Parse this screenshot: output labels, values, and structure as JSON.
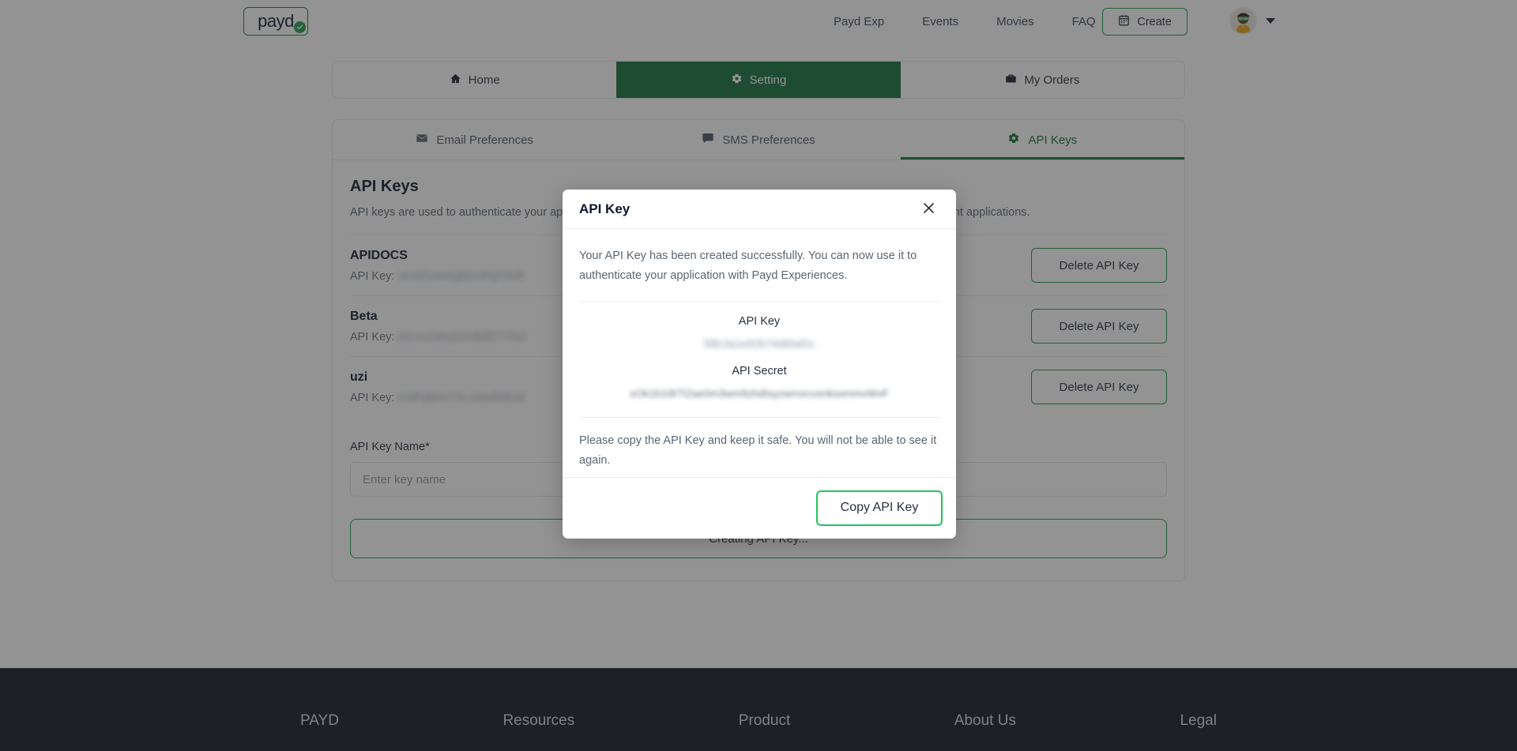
{
  "header": {
    "logo_text": "payd",
    "logo_icon": "check-circle-icon",
    "nav": [
      {
        "label": "Payd Exp"
      },
      {
        "label": "Events"
      },
      {
        "label": "Movies"
      },
      {
        "label": "FAQ"
      }
    ],
    "create_button": {
      "label": "Create",
      "icon": "calendar-icon"
    },
    "avatar": {
      "icon": "user-avatar"
    },
    "caret_icon": "chevron-down-icon"
  },
  "main_tabs": [
    {
      "label": "Home",
      "icon": "home-icon",
      "active": false
    },
    {
      "label": "Setting",
      "icon": "gear-icon",
      "active": true
    },
    {
      "label": "My Orders",
      "icon": "briefcase-icon",
      "active": false
    }
  ],
  "sub_tabs": [
    {
      "label": "Email Preferences",
      "icon": "envelope-icon",
      "active": false
    },
    {
      "label": "SMS Preferences",
      "icon": "chat-bubble-icon",
      "active": false
    },
    {
      "label": "API Keys",
      "icon": "gear-icon",
      "active": true
    }
  ],
  "panel": {
    "title": "API Keys",
    "description": "API keys are used to authenticate your applications with Payd Experiences. You can create multiple API keys for different applications.",
    "key_label_prefix": "API Key:",
    "keys": [
      {
        "name": "APIDOCS",
        "value": "xK4d1ow0q8ZmPqT3vR",
        "delete_label": "Delete API Key"
      },
      {
        "name": "Beta",
        "value": "j9Lmv2Wq5XnBdE7rTaZ",
        "delete_label": "Delete API Key"
      },
      {
        "name": "uzi",
        "value": "m3Pq8XvT2LcNwR5kJd",
        "delete_label": "Delete API Key"
      }
    ],
    "form": {
      "label": "API Key Name*",
      "placeholder": "Enter key name",
      "value": "",
      "submit_label": "Creating API Key..."
    }
  },
  "modal": {
    "title": "API Key",
    "close_icon": "close-icon",
    "intro": "Your API Key has been created successfully. You can now use it to authenticate your application with Payd Experiences.",
    "api_key_label": "API Key",
    "api_key_value": "5f8c3a1e92b74d60af2c",
    "api_secret_label": "API Secret",
    "api_secret_value": "xOk1b1i9/7i2ae0m3wm9zhdtsyzwrnxcvsnkssmmvWvF",
    "warning": "Please copy the API Key and keep it safe. You will not be able to see it again.",
    "copy_button": "Copy API Key"
  },
  "footer": {
    "columns": [
      {
        "title": "PAYD"
      },
      {
        "title": "Resources"
      },
      {
        "title": "Product"
      },
      {
        "title": "About Us"
      },
      {
        "title": "Legal"
      }
    ]
  },
  "colors": {
    "brand_green": "#137038",
    "accent_green": "#1f9a4d",
    "bright_green": "#22c55e",
    "footer_bg": "#121826"
  }
}
